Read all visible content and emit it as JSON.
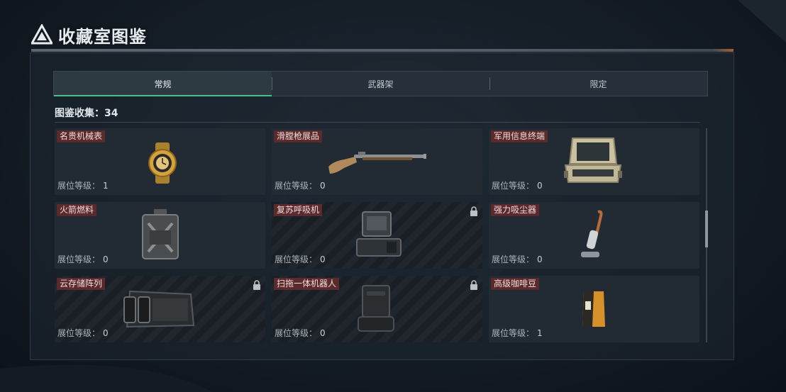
{
  "header": {
    "title": "收藏室图鉴",
    "logo_icon": "triangle-logo-icon"
  },
  "tabs": [
    {
      "label": "常规",
      "active": true
    },
    {
      "label": "武器架",
      "active": false
    },
    {
      "label": "限定",
      "active": false
    }
  ],
  "collection": {
    "label": "图鉴收集：34"
  },
  "level_label": "展位等级：",
  "items": [
    {
      "name": "名贵机械表",
      "level": "1",
      "locked": false,
      "icon": "gold-watch-icon"
    },
    {
      "name": "滑膛枪展品",
      "level": "0",
      "locked": false,
      "icon": "musket-icon"
    },
    {
      "name": "军用信息终端",
      "level": "0",
      "locked": false,
      "icon": "field-terminal-icon"
    },
    {
      "name": "火箭燃料",
      "level": "0",
      "locked": false,
      "icon": "fuel-canister-icon"
    },
    {
      "name": "复苏呼吸机",
      "level": "0",
      "locked": true,
      "icon": "ventilator-icon"
    },
    {
      "name": "强力吸尘器",
      "level": "0",
      "locked": false,
      "icon": "vacuum-cleaner-icon"
    },
    {
      "name": "云存储阵列",
      "level": "0",
      "locked": true,
      "icon": "storage-array-icon"
    },
    {
      "name": "扫拖一体机器人",
      "level": "0",
      "locked": true,
      "icon": "robot-vacuum-station-icon"
    },
    {
      "name": "高级咖啡豆",
      "level": "1",
      "locked": false,
      "icon": "coffee-bag-icon"
    }
  ],
  "colors": {
    "accent": "#46c08e",
    "name_tag": "#5b2a2d",
    "warning_accent": "#c8733a"
  }
}
